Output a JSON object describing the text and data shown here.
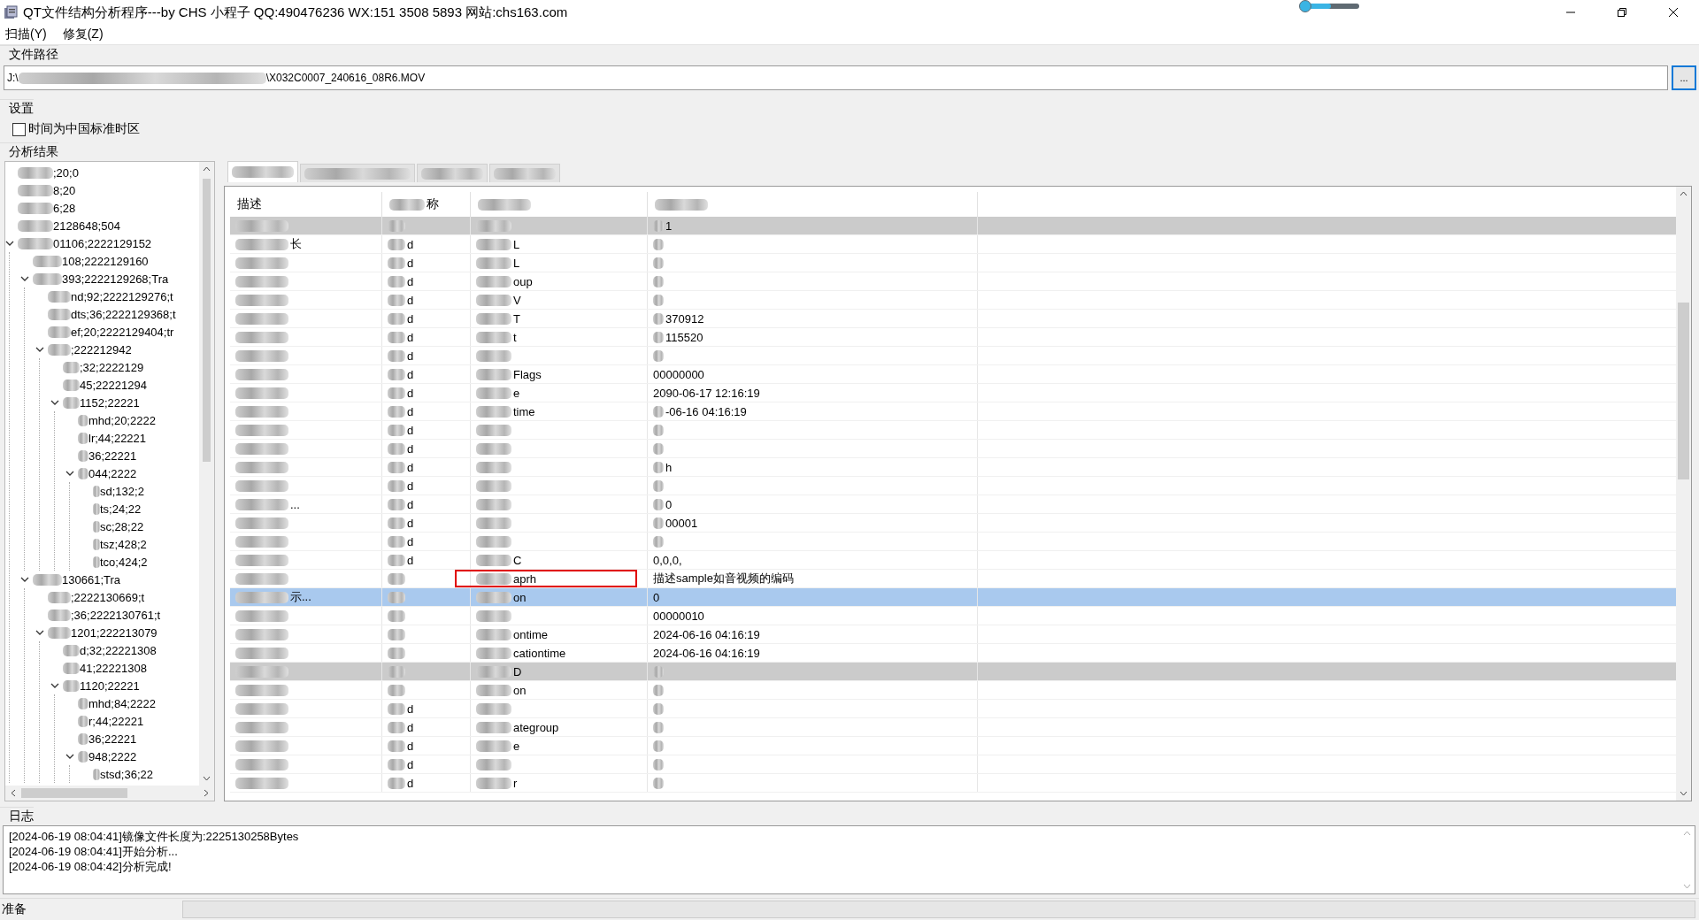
{
  "window": {
    "title": "QT文件结构分析程序---by CHS 小程子 QQ:490476236  WX:151 3508 5893  网站:chs163.com",
    "slider": {
      "level": 0.5
    }
  },
  "menu": [
    {
      "label": "扫描(Y)"
    },
    {
      "label": "修复(Z)"
    }
  ],
  "path_group": {
    "label": "文件路径",
    "value_start": "J:\\",
    "value_end": "\\X032C0007_240616_08R6.MOV",
    "browse": "..."
  },
  "settings_group": {
    "label": "设置",
    "checkbox": {
      "label": "时间为中国标准时区",
      "checked": false
    }
  },
  "results_group": {
    "label": "分析结果"
  },
  "tree": [
    {
      "text": ";20;0"
    },
    {
      "text": "8;20"
    },
    {
      "text": "6;28"
    },
    {
      "text": "2128648;504"
    },
    {
      "text": "01106;2222129152",
      "expanded": true,
      "children": [
        {
          "text": "108;2222129160"
        },
        {
          "text": "393;2222129268;Tra",
          "expanded": true,
          "children": [
            {
              "text": "nd;92;2222129276;t"
            },
            {
              "text": "dts;36;2222129368;t"
            },
            {
              "text": "ef;20;2222129404;tr"
            },
            {
              "text": ";222212942",
              "expanded": true,
              "children": [
                {
                  "text": ";32;2222129"
                },
                {
                  "text": "45;22221294"
                },
                {
                  "text": "1152;22221",
                  "expanded": true,
                  "children": [
                    {
                      "text": "mhd;20;2222"
                    },
                    {
                      "text": "lr;44;22221"
                    },
                    {
                      "text": "36;22221"
                    },
                    {
                      "text": "044;2222",
                      "expanded": true,
                      "children": [
                        {
                          "text": "sd;132;2"
                        },
                        {
                          "text": "ts;24;22"
                        },
                        {
                          "text": "sc;28;22"
                        },
                        {
                          "text": "tsz;428;2"
                        },
                        {
                          "text": "tco;424;2"
                        }
                      ]
                    }
                  ]
                }
              ]
            }
          ]
        },
        {
          "text": "130661;Tra",
          "expanded": true,
          "children": [
            {
              "text": ";2222130669;t"
            },
            {
              "text": ";36;2222130761;t"
            },
            {
              "text": "1201;222213079",
              "expanded": true,
              "children": [
                {
                  "text": "d;32;22221308"
                },
                {
                  "text": "41;22221308"
                },
                {
                  "text": "1120;22221",
                  "expanded": true,
                  "children": [
                    {
                      "text": "mhd;84;2222"
                    },
                    {
                      "text": "r;44;22221"
                    },
                    {
                      "text": "36;22221"
                    },
                    {
                      "text": "948;2222",
                      "expanded": true,
                      "children": [
                        {
                          "text": "stsd;36;22"
                        }
                      ]
                    }
                  ]
                }
              ]
            }
          ]
        }
      ]
    }
  ],
  "tabs": [
    {
      "selected": true
    },
    {
      "selected": false
    },
    {
      "selected": false
    },
    {
      "selected": false
    }
  ],
  "table": {
    "columns": [
      "描述",
      "称",
      "",
      ""
    ],
    "rows": [
      {
        "kind": "section",
        "selected": false,
        "cells": [
          "",
          "",
          "",
          "1"
        ]
      },
      {
        "kind": "field",
        "selected": false,
        "cells": [
          "长",
          "d",
          "L",
          ""
        ]
      },
      {
        "kind": "field",
        "selected": false,
        "cells": [
          "",
          "d",
          "L",
          ""
        ]
      },
      {
        "kind": "field",
        "selected": false,
        "cells": [
          "",
          "d",
          "oup",
          ""
        ]
      },
      {
        "kind": "field",
        "selected": false,
        "cells": [
          "",
          "d",
          "V",
          ""
        ]
      },
      {
        "kind": "field",
        "selected": false,
        "cells": [
          "",
          "d",
          "T",
          "370912"
        ]
      },
      {
        "kind": "field",
        "selected": false,
        "cells": [
          "",
          "d",
          "t",
          "115520"
        ]
      },
      {
        "kind": "field",
        "selected": false,
        "cells": [
          "",
          "d",
          "",
          ""
        ]
      },
      {
        "kind": "field",
        "selected": false,
        "cells": [
          "",
          "d",
          "Flags",
          "00000000"
        ]
      },
      {
        "kind": "field",
        "selected": false,
        "cells": [
          "",
          "d",
          "e",
          "2090-06-17 12:16:19"
        ]
      },
      {
        "kind": "field",
        "selected": false,
        "cells": [
          "",
          "d",
          "time",
          "-06-16 04:16:19"
        ]
      },
      {
        "kind": "field",
        "selected": false,
        "cells": [
          "",
          "d",
          "",
          ""
        ]
      },
      {
        "kind": "field",
        "selected": false,
        "cells": [
          "",
          "d",
          "",
          ""
        ]
      },
      {
        "kind": "field",
        "selected": false,
        "cells": [
          "",
          "d",
          "",
          "h"
        ]
      },
      {
        "kind": "field",
        "selected": false,
        "cells": [
          "",
          "d",
          "",
          ""
        ]
      },
      {
        "kind": "field",
        "selected": false,
        "cells": [
          "...",
          "d",
          "",
          "0"
        ]
      },
      {
        "kind": "field",
        "selected": false,
        "cells": [
          "",
          "d",
          "",
          "00001"
        ]
      },
      {
        "kind": "field",
        "selected": false,
        "cells": [
          "",
          "d",
          "",
          ""
        ]
      },
      {
        "kind": "field",
        "selected": false,
        "cells": [
          "",
          "d",
          "C",
          "0,0,0,"
        ]
      },
      {
        "kind": "field",
        "selected": false,
        "highlighted": true,
        "cells": [
          "",
          "",
          "aprh",
          "描述sample如音视频的编码"
        ]
      },
      {
        "kind": "field",
        "selected": true,
        "cells": [
          "示...",
          "",
          "on",
          "0"
        ]
      },
      {
        "kind": "field",
        "selected": false,
        "cells": [
          "",
          "",
          "",
          "00000010"
        ]
      },
      {
        "kind": "field",
        "selected": false,
        "cells": [
          "",
          "",
          "ontime",
          "2024-06-16 04:16:19"
        ]
      },
      {
        "kind": "field",
        "selected": false,
        "cells": [
          "",
          "",
          "cationtime",
          "2024-06-16 04:16:19"
        ]
      },
      {
        "kind": "section",
        "selected": false,
        "cells": [
          "",
          "",
          "D",
          ""
        ]
      },
      {
        "kind": "field",
        "selected": false,
        "cells": [
          "",
          "",
          "on",
          ""
        ]
      },
      {
        "kind": "field",
        "selected": false,
        "cells": [
          "",
          "d",
          "",
          ""
        ]
      },
      {
        "kind": "field",
        "selected": false,
        "cells": [
          "",
          "d",
          "ategroup",
          ""
        ]
      },
      {
        "kind": "field",
        "selected": false,
        "cells": [
          "",
          "d",
          "e",
          ""
        ]
      },
      {
        "kind": "field",
        "selected": false,
        "cells": [
          "",
          "d",
          "",
          ""
        ]
      },
      {
        "kind": "field",
        "selected": false,
        "cells": [
          "",
          "d",
          "r",
          ""
        ]
      }
    ]
  },
  "log_group": {
    "label": "日志",
    "lines": [
      "[2024-06-19 08:04:41]镜像文件长度为:2225130258Bytes",
      "[2024-06-19 08:04:41]开始分析...",
      "[2024-06-19 08:04:42]分析完成!"
    ]
  },
  "status_bar": {
    "text": "准备"
  }
}
